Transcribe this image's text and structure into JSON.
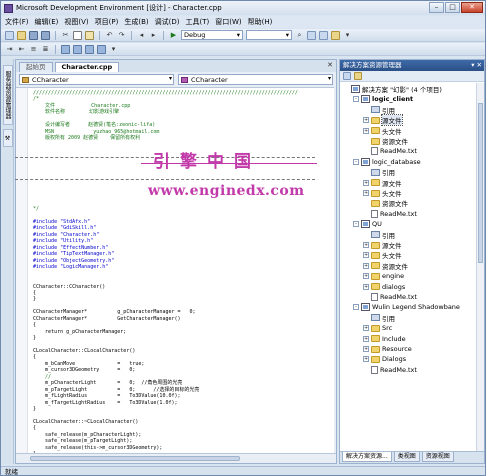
{
  "window": {
    "title": "Microsoft Development Environment [设计] - Character.cpp"
  },
  "titlebar_buttons": {
    "minimize": "–",
    "maximize": "□",
    "close": "✕"
  },
  "menu": [
    "文件(F)",
    "编辑(E)",
    "视图(V)",
    "项目(P)",
    "生成(B)",
    "调试(D)",
    "工具(T)",
    "窗口(W)",
    "帮助(H)"
  ],
  "toolbar": {
    "config": "Debug"
  },
  "left_strip": {
    "tabs": [
      "服务器资源管理器",
      "工具箱"
    ]
  },
  "editor": {
    "tabs": [
      {
        "label": "起始页",
        "active": false
      },
      {
        "label": "Character.cpp",
        "active": true
      }
    ],
    "close_glyph": "✕",
    "nav_left": "CCharacter",
    "nav_right": "CCharacter",
    "code_lines": [
      {
        "t": "////////////////////////////////////////////////////////////////////////////////////////",
        "c": "cm"
      },
      {
        "t": "/*",
        "c": "cm"
      },
      {
        "t": "    文件            Character.cpp",
        "c": "cm"
      },
      {
        "t": "    软件名称        幻影游戏引擎",
        "c": "cm"
      },
      {
        "t": "",
        "c": "cm"
      },
      {
        "t": "    设计编写者      赵德贤(笔名:zeonic-lifa)",
        "c": "cm"
      },
      {
        "t": "    MSN             yuzhao_965@hotmail.com",
        "c": "cm"
      },
      {
        "t": "    版权所有 2009 赵德贤    保留所有权利",
        "c": "cm"
      },
      {
        "t": "",
        "c": "cm"
      },
      {
        "t": "",
        "c": "cm"
      },
      {
        "t": "",
        "c": "cm"
      },
      {
        "t": "",
        "c": "cm"
      },
      {
        "t": "",
        "c": "cm"
      },
      {
        "t": "",
        "c": "cm"
      },
      {
        "t": "",
        "c": "cm"
      },
      {
        "t": "",
        "c": "cm"
      },
      {
        "t": "",
        "c": "cm"
      },
      {
        "t": "",
        "c": "cm"
      },
      {
        "t": "*/",
        "c": "cm"
      },
      {
        "t": "",
        "c": "id"
      },
      {
        "t": "#include \"StdAfx.h\"",
        "c": "pp"
      },
      {
        "t": "#include \"GdiSkill.h\"",
        "c": "pp"
      },
      {
        "t": "#include \"Character.h\"",
        "c": "pp"
      },
      {
        "t": "#include \"Utility.h\"",
        "c": "pp"
      },
      {
        "t": "#include \"EffectNumber.h\"",
        "c": "pp"
      },
      {
        "t": "#include \"TipTextManager.h\"",
        "c": "pp"
      },
      {
        "t": "#include \"ObjectGeometry.h\"",
        "c": "pp"
      },
      {
        "t": "#include \"LogicManager.h\"",
        "c": "pp"
      },
      {
        "t": "",
        "c": "id"
      },
      {
        "t": "",
        "c": "id"
      },
      {
        "t": "CCharacter::CCharacter()",
        "c": "id"
      },
      {
        "t": "{",
        "c": "id"
      },
      {
        "t": "}",
        "c": "id"
      },
      {
        "t": "",
        "c": "id"
      },
      {
        "t": "CCharacterManager*          g_pCharacterManager =   0;",
        "c": "id"
      },
      {
        "t": "CCharacterManager*          GetCharacterManager()",
        "c": "id"
      },
      {
        "t": "{",
        "c": "id"
      },
      {
        "t": "    return g_pCharacterManager;",
        "c": "id"
      },
      {
        "t": "}",
        "c": "id"
      },
      {
        "t": "",
        "c": "id"
      },
      {
        "t": "CLocalCharacter::CLocalCharacter()",
        "c": "id"
      },
      {
        "t": "{",
        "c": "id"
      },
      {
        "t": "    m_bCanMove              =   true;",
        "c": "id"
      },
      {
        "t": "    m_cursor3DGeometry      =   0;",
        "c": "id"
      },
      {
        "t": "    //",
        "c": "cm"
      },
      {
        "t": "    m_pCharacterLight       =   0;  //角色周围的光亮",
        "c": "id"
      },
      {
        "t": "    m_pTargetLight          =   0;      //选择的目标的光亮",
        "c": "id"
      },
      {
        "t": "    m_fLightRadius          =   To3DValue(10.0f);",
        "c": "id"
      },
      {
        "t": "    m_fTargetLightRadius    =   To3DValue(1.0f);",
        "c": "id"
      },
      {
        "t": "}",
        "c": "id"
      },
      {
        "t": "",
        "c": "id"
      },
      {
        "t": "CLocalCharacter::~CLocalCharacter()",
        "c": "id"
      },
      {
        "t": "{",
        "c": "id"
      },
      {
        "t": "    safe_release(m_pCharacterLight);",
        "c": "id"
      },
      {
        "t": "    safe_release(m_pTargetLight);",
        "c": "id"
      },
      {
        "t": "    safe_release(this->m_cursor3DGeometry);",
        "c": "id"
      },
      {
        "t": "}",
        "c": "id"
      }
    ],
    "watermark": {
      "chinese": "引擎中国",
      "url": "www.enginedx.com"
    }
  },
  "solution": {
    "header": "解决方案资源管理器",
    "header_buttons": "▾ ✕",
    "items": [
      {
        "label": "解决方案 \"幻影\" (4 个项目)",
        "icon": "solution",
        "depth": 0,
        "exp": ""
      },
      {
        "label": "logic_client",
        "icon": "project",
        "depth": 1,
        "exp": "-",
        "bold": true
      },
      {
        "label": "引用",
        "icon": "ref",
        "depth": 2,
        "exp": ""
      },
      {
        "label": "源文件",
        "icon": "folder",
        "depth": 2,
        "exp": "+",
        "selected": true
      },
      {
        "label": "头文件",
        "icon": "folder",
        "depth": 2,
        "exp": "+"
      },
      {
        "label": "资源文件",
        "icon": "folder",
        "depth": 2,
        "exp": ""
      },
      {
        "label": "ReadMe.txt",
        "icon": "txt",
        "depth": 2,
        "exp": ""
      },
      {
        "label": "logic_database",
        "icon": "project",
        "depth": 1,
        "exp": "-"
      },
      {
        "label": "引用",
        "icon": "ref",
        "depth": 2,
        "exp": ""
      },
      {
        "label": "源文件",
        "icon": "folder",
        "depth": 2,
        "exp": "+"
      },
      {
        "label": "头文件",
        "icon": "folder",
        "depth": 2,
        "exp": "+"
      },
      {
        "label": "资源文件",
        "icon": "folder",
        "depth": 2,
        "exp": ""
      },
      {
        "label": "ReadMe.txt",
        "icon": "txt",
        "depth": 2,
        "exp": ""
      },
      {
        "label": "QU",
        "icon": "project",
        "depth": 1,
        "exp": "-"
      },
      {
        "label": "引用",
        "icon": "ref",
        "depth": 2,
        "exp": ""
      },
      {
        "label": "源文件",
        "icon": "folder",
        "depth": 2,
        "exp": "+"
      },
      {
        "label": "头文件",
        "icon": "folder",
        "depth": 2,
        "exp": "+"
      },
      {
        "label": "资源文件",
        "icon": "folder",
        "depth": 2,
        "exp": "+"
      },
      {
        "label": "engine",
        "icon": "folder",
        "depth": 2,
        "exp": "+"
      },
      {
        "label": "dialogs",
        "icon": "folder",
        "depth": 2,
        "exp": "+"
      },
      {
        "label": "ReadMe.txt",
        "icon": "txt",
        "depth": 2,
        "exp": ""
      },
      {
        "label": "Wulin Legend Shadowbane",
        "icon": "project",
        "depth": 1,
        "exp": "-"
      },
      {
        "label": "引用",
        "icon": "ref",
        "depth": 2,
        "exp": ""
      },
      {
        "label": "Src",
        "icon": "folder",
        "depth": 2,
        "exp": "+"
      },
      {
        "label": "Include",
        "icon": "folder",
        "depth": 2,
        "exp": "+"
      },
      {
        "label": "Resource",
        "icon": "folder",
        "depth": 2,
        "exp": "+"
      },
      {
        "label": "Dialogs",
        "icon": "folder",
        "depth": 2,
        "exp": "+"
      },
      {
        "label": "ReadMe.txt",
        "icon": "txt",
        "depth": 2,
        "exp": ""
      }
    ],
    "bottom_tabs": [
      "解决方案资源...",
      "类视图",
      "资源视图"
    ]
  },
  "status": {
    "text": "就绪"
  },
  "colors": {
    "accent": "#2b4f86",
    "watermark": "#c23aa9",
    "comment": "#1c7b1c",
    "keyword": "#0000cc"
  }
}
